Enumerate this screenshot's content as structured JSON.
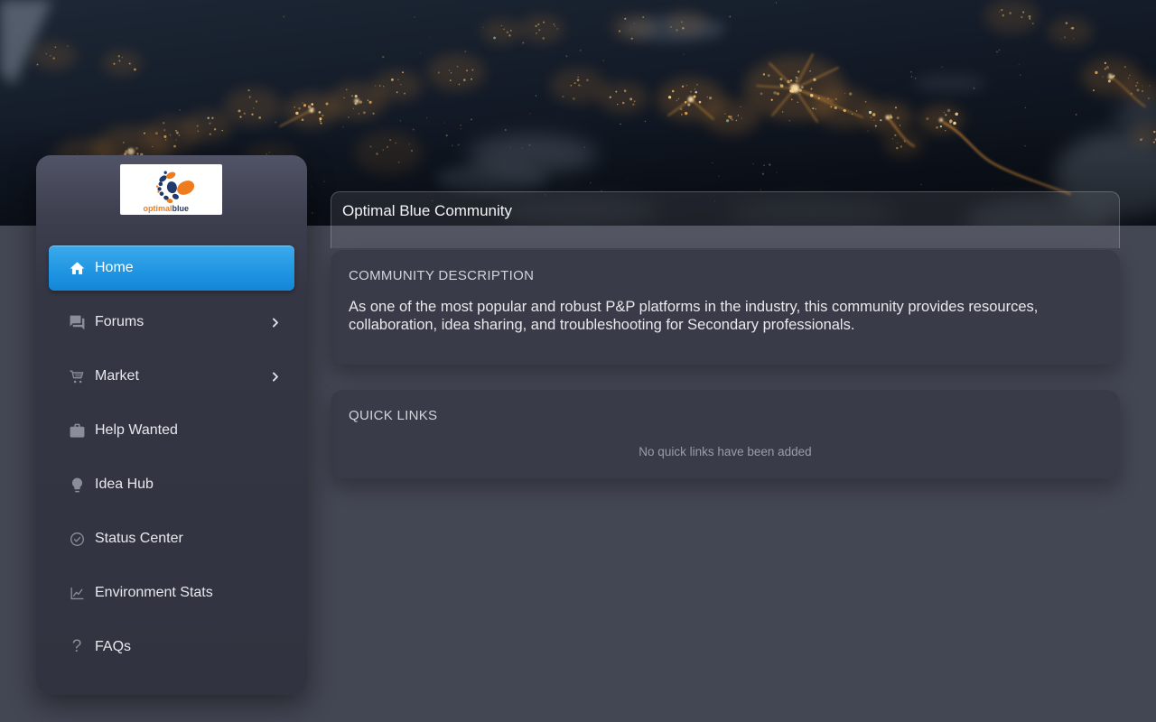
{
  "brand": {
    "word_1": "optimal",
    "word_2": "blue"
  },
  "sidebar": {
    "items": [
      {
        "label": "Home",
        "icon": "home-icon",
        "active": true,
        "has_submenu": false
      },
      {
        "label": "Forums",
        "icon": "forum-icon",
        "active": false,
        "has_submenu": true
      },
      {
        "label": "Market",
        "icon": "cart-icon",
        "active": false,
        "has_submenu": true
      },
      {
        "label": "Help Wanted",
        "icon": "briefcase-icon",
        "active": false,
        "has_submenu": false
      },
      {
        "label": "Idea Hub",
        "icon": "lightbulb-icon",
        "active": false,
        "has_submenu": false
      },
      {
        "label": "Status Center",
        "icon": "check-circle-icon",
        "active": false,
        "has_submenu": false
      },
      {
        "label": "Environment Stats",
        "icon": "line-chart-icon",
        "active": false,
        "has_submenu": false
      },
      {
        "label": "FAQs",
        "icon": "question-mark-icon",
        "active": false,
        "has_submenu": false
      }
    ]
  },
  "icons": {
    "question_glyph": "?"
  },
  "main": {
    "header_title": "Optimal Blue Community",
    "sections": [
      {
        "title": "COMMUNITY DESCRIPTION",
        "body": "As one of the most popular and robust P&P platforms in the industry, this community provides resources, collaboration, idea sharing, and troubleshooting for Secondary professionals."
      },
      {
        "title": "QUICK LINKS",
        "empty_message": "No quick links have been added"
      }
    ]
  },
  "colors": {
    "accent_blue": "#2196e2",
    "logo_orange": "#ee7c1f",
    "logo_navy": "#203a6e",
    "sidebar_bg": "#313340",
    "card_bg": "#393b48",
    "page_bg": "#434653"
  }
}
